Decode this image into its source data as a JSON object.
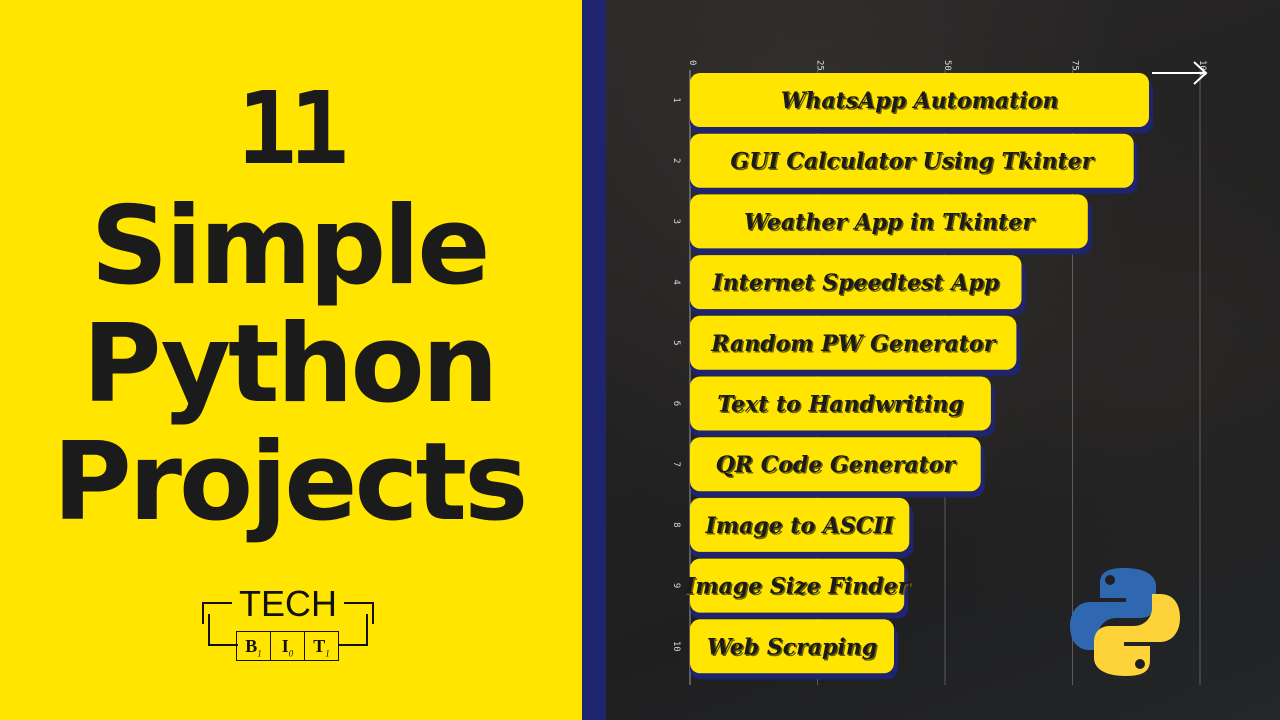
{
  "poster": {
    "count": "11",
    "title_lines": [
      "Simple",
      "Python",
      "Projects"
    ],
    "background_color": "#ffe500",
    "accent_blue": "#1e246e",
    "text_color": "#1b1b1b"
  },
  "logo": {
    "top_text": "TECH",
    "cells": [
      {
        "letter": "B",
        "sub": "1"
      },
      {
        "letter": "I",
        "sub": "0"
      },
      {
        "letter": "T",
        "sub": "1"
      }
    ]
  },
  "python_logo": {
    "icon": "python-logo-icon",
    "colors": [
      "#2f68b0",
      "#fed33a"
    ]
  },
  "arrow_icon": "arrow-right-icon",
  "chart_data": {
    "type": "bar",
    "orientation": "horizontal",
    "title": "",
    "xlabel": "",
    "ylabel": "",
    "xlim": [
      0,
      100
    ],
    "x_ticks": [
      "0",
      "25",
      "50",
      "75",
      "100"
    ],
    "y_ticks": [
      "1",
      "2",
      "3",
      "4",
      "5",
      "6",
      "7",
      "8",
      "9",
      "10"
    ],
    "grid": "vertical",
    "categories": [
      "WhatsApp Automation",
      "GUI Calculator Using Tkinter",
      "Weather App in Tkinter",
      "Internet Speedtest App",
      "Random PW Generator",
      "Text to Handwriting",
      "QR Code Generator",
      "Image to ASCII",
      "Image Size Finder",
      "Web Scraping"
    ],
    "values": [
      90,
      87,
      78,
      65,
      64,
      59,
      57,
      43,
      42,
      40
    ],
    "bar_color": "#ffe500",
    "shadow_color": "#1e246e"
  }
}
